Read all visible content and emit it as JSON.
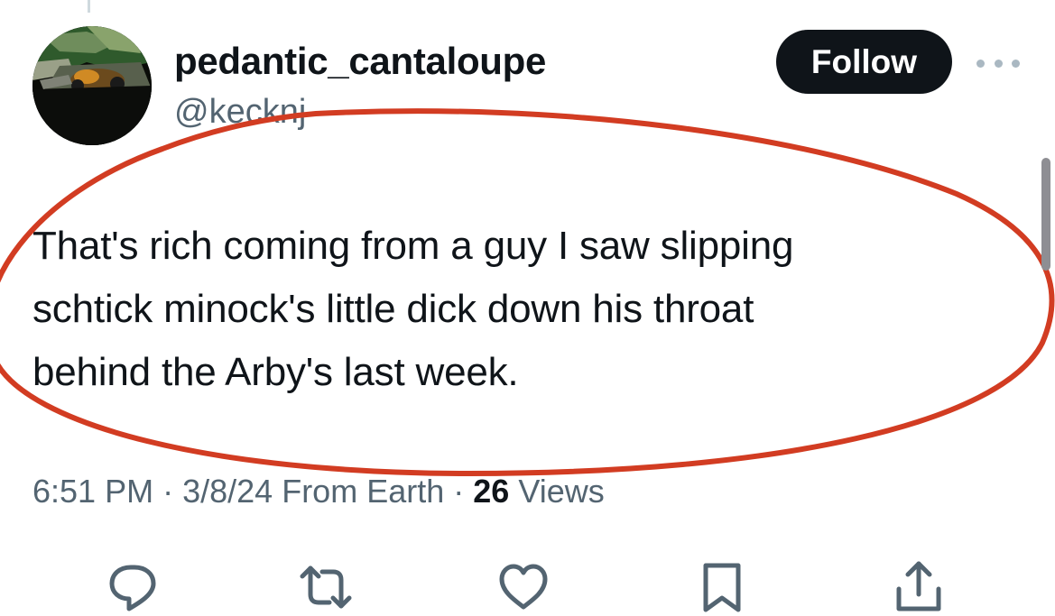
{
  "tweet": {
    "display_name": "pedantic_cantaloupe",
    "handle": "@kecknj",
    "follow_label": "Follow",
    "text_lines": [
      "That's rich coming from a guy I saw slipping",
      "schtick minock's little dick down his throat",
      "behind the Arby's last week."
    ],
    "time": "6:51 PM",
    "date": "3/8/24",
    "source": "From Earth",
    "separator": "·",
    "views_count": "26",
    "views_label": "Views"
  },
  "actions": [
    {
      "name": "reply-icon"
    },
    {
      "name": "retweet-icon"
    },
    {
      "name": "like-icon"
    },
    {
      "name": "bookmark-icon"
    },
    {
      "name": "share-icon"
    }
  ],
  "colors": {
    "text": "#0f1419",
    "secondary": "#536471",
    "follow_bg": "#0f1419",
    "annotation": "#d23c22"
  }
}
